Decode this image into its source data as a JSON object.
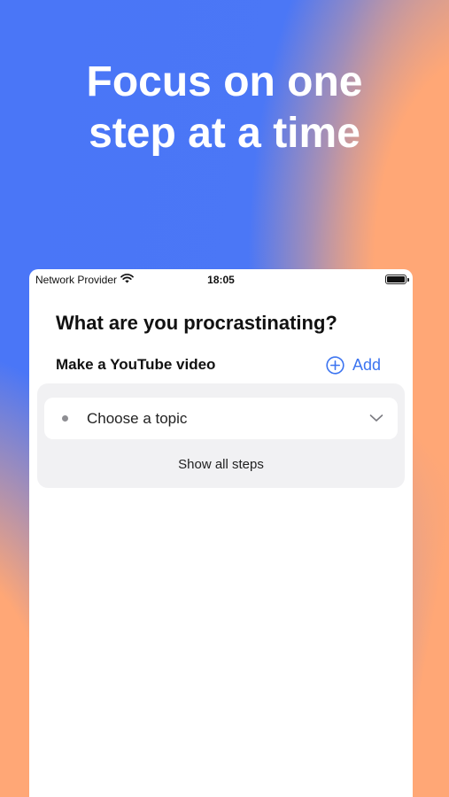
{
  "headline": {
    "line1": "Focus on one",
    "line2": "step at a time"
  },
  "status_bar": {
    "carrier": "Network Provider",
    "time": "18:05",
    "icons": [
      "wifi-icon",
      "battery-icon"
    ]
  },
  "screen": {
    "question": "What are you procrastinating?",
    "task_title": "Make a YouTube video",
    "add_label": "Add",
    "steps": [
      {
        "label": "Choose a topic"
      }
    ],
    "show_all_label": "Show all steps"
  },
  "colors": {
    "accent": "#3c74f0",
    "background_blue": "#4a78f6",
    "background_orange": "#ffa776",
    "card_gray": "#f1f1f3"
  }
}
